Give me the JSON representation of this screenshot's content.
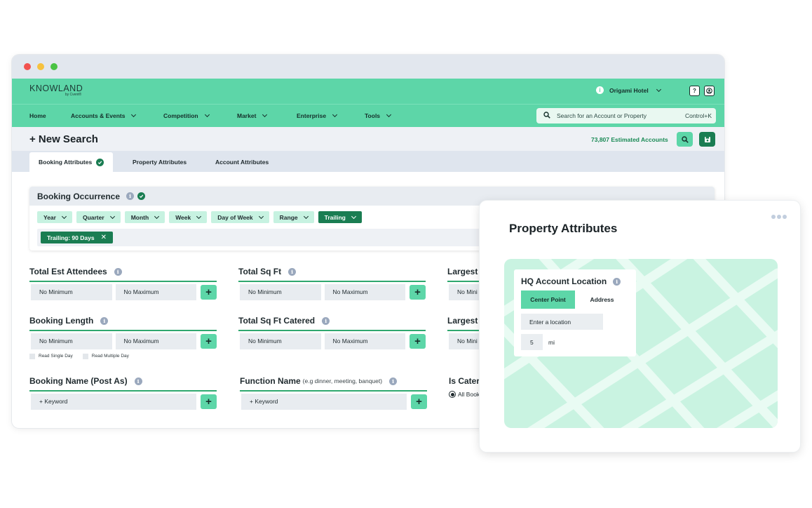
{
  "colors": {
    "brand_green": "#5dd6a8",
    "dark_green": "#1a7d52",
    "chip_green": "#c7f2e1",
    "map_green": "#c9f3e1",
    "estimate_text": "#1a8a55"
  },
  "brand": {
    "name": "KNOWLAND",
    "tagline": "by Cvent®"
  },
  "header": {
    "property_name": "Origami Hotel",
    "icons": [
      "info-icon",
      "chevron-down-icon",
      "help-icon",
      "user-icon"
    ]
  },
  "nav": {
    "items": [
      {
        "label": "Home"
      },
      {
        "label": "Accounts & Events"
      },
      {
        "label": "Competition"
      },
      {
        "label": "Market"
      },
      {
        "label": "Enterprise"
      },
      {
        "label": "Tools"
      }
    ],
    "search_placeholder": "Search for an Account or Property",
    "search_shortcut": "Control+K"
  },
  "search": {
    "title": "+ New Search",
    "estimated": "73,807 Estimated Accounts"
  },
  "tabs": [
    {
      "label": "Booking Attributes"
    },
    {
      "label": "Property Attributes"
    },
    {
      "label": "Account Attributes"
    }
  ],
  "occurrence": {
    "title": "Booking Occurrence",
    "chips": [
      {
        "label": "Year"
      },
      {
        "label": "Quarter"
      },
      {
        "label": "Month"
      },
      {
        "label": "Week"
      },
      {
        "label": "Day of Week"
      },
      {
        "label": "Range"
      },
      {
        "label": "Trailing"
      }
    ],
    "active_tag": "Trailing: 90 Days"
  },
  "fields": {
    "attendees": {
      "title": "Total Est Attendees",
      "min": "No Minimum",
      "max": "No Maximum"
    },
    "sqft": {
      "title": "Total Sq Ft",
      "min": "No Minimum",
      "max": "No Maximum"
    },
    "largest1": {
      "title": "Largest",
      "min": "No Mini"
    },
    "length": {
      "title": "Booking Length",
      "min": "No Minimum",
      "max": "No Maximum",
      "check_single": "Read Single Day",
      "check_multiple": "Read Multiple Day"
    },
    "sqft_catered": {
      "title": "Total Sq Ft Catered",
      "min": "No Minimum",
      "max": "No Maximum"
    },
    "largest2": {
      "title": "Largest",
      "min": "No Mini"
    },
    "booking_name": {
      "title": "Booking Name (Post As)",
      "keyword": "+ Keyword"
    },
    "function_name": {
      "title": "Function Name",
      "hint": "(e.g dinner, meeting, banquet)",
      "keyword": "+ Keyword"
    },
    "is_catered": {
      "title": "Is Cater",
      "radio": "All Book"
    }
  },
  "property_card": {
    "title": "Property Attributes",
    "hq_title": "HQ Account Location",
    "seg_center": "Center Point",
    "seg_address": "Address",
    "location_placeholder": "Enter a location",
    "radius_value": "5",
    "radius_unit": "mi"
  }
}
